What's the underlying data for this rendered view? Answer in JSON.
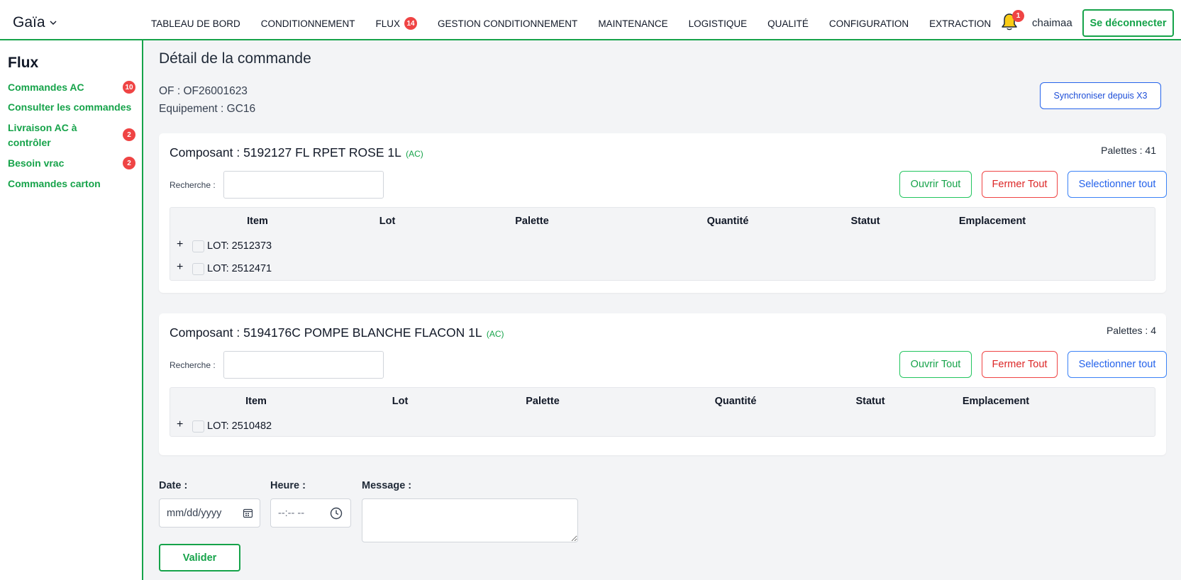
{
  "app": {
    "brand": "Gaïa"
  },
  "nav": {
    "items": [
      {
        "label": "TABLEAU DE BORD"
      },
      {
        "label": "CONDITIONNEMENT"
      },
      {
        "label": "FLUX",
        "badge": "14"
      },
      {
        "label": "GESTION CONDITIONNEMENT"
      },
      {
        "label": "MAINTENANCE"
      },
      {
        "label": "LOGISTIQUE"
      },
      {
        "label": "QUALITÉ"
      },
      {
        "label": "CONFIGURATION"
      },
      {
        "label": "EXTRACTION"
      }
    ],
    "notifications_count": "1",
    "username": "chaimaa",
    "logout_label": "Se déconnecter"
  },
  "sidebar": {
    "title": "Flux",
    "items": [
      {
        "label": "Commandes AC",
        "badge": "10"
      },
      {
        "label": "Consulter les commandes"
      },
      {
        "label": "Livraison AC à contrôler",
        "badge": "2"
      },
      {
        "label": "Besoin vrac",
        "badge": "2"
      },
      {
        "label": "Commandes carton"
      }
    ]
  },
  "main": {
    "title": "Détail de la commande",
    "of_line": "OF : OF26001623",
    "equipement_line": "Equipement : GC16",
    "sync_label": "Synchroniser depuis X3",
    "components": [
      {
        "title": "Composant : 5192127 FL RPET ROSE 1L",
        "tag": "(AC)",
        "palettes": "Palettes : 41",
        "search_label": "Recherche :",
        "search_value": "",
        "open_all": "Ouvrir Tout",
        "close_all": "Fermer Tout",
        "select_all": "Selectionner tout",
        "headers": [
          "Item",
          "Lot",
          "Palette",
          "Quantité",
          "Statut",
          "Emplacement"
        ],
        "lots": [
          "LOT: 2512373",
          "LOT: 2512471"
        ]
      },
      {
        "title": "Composant : 5194176C POMPE BLANCHE FLACON 1L",
        "tag": "(AC)",
        "palettes": "Palettes : 4",
        "search_label": "Recherche :",
        "search_value": "",
        "open_all": "Ouvrir Tout",
        "close_all": "Fermer Tout",
        "select_all": "Selectionner tout",
        "headers": [
          "Item",
          "Lot",
          "Palette",
          "Quantité",
          "Statut",
          "Emplacement"
        ],
        "lots": [
          "LOT: 2510482"
        ]
      }
    ],
    "form": {
      "date_label": "Date :",
      "date_placeholder": "mm/dd/yyyy",
      "time_label": "Heure :",
      "time_placeholder": "--:-- --",
      "message_label": "Message :",
      "message_value": "",
      "submit_label": "Valider"
    }
  },
  "colors": {
    "accent_green": "#16a34a",
    "danger_red": "#ef4444",
    "primary_blue": "#2563eb",
    "bell_yellow": "#facc15"
  }
}
